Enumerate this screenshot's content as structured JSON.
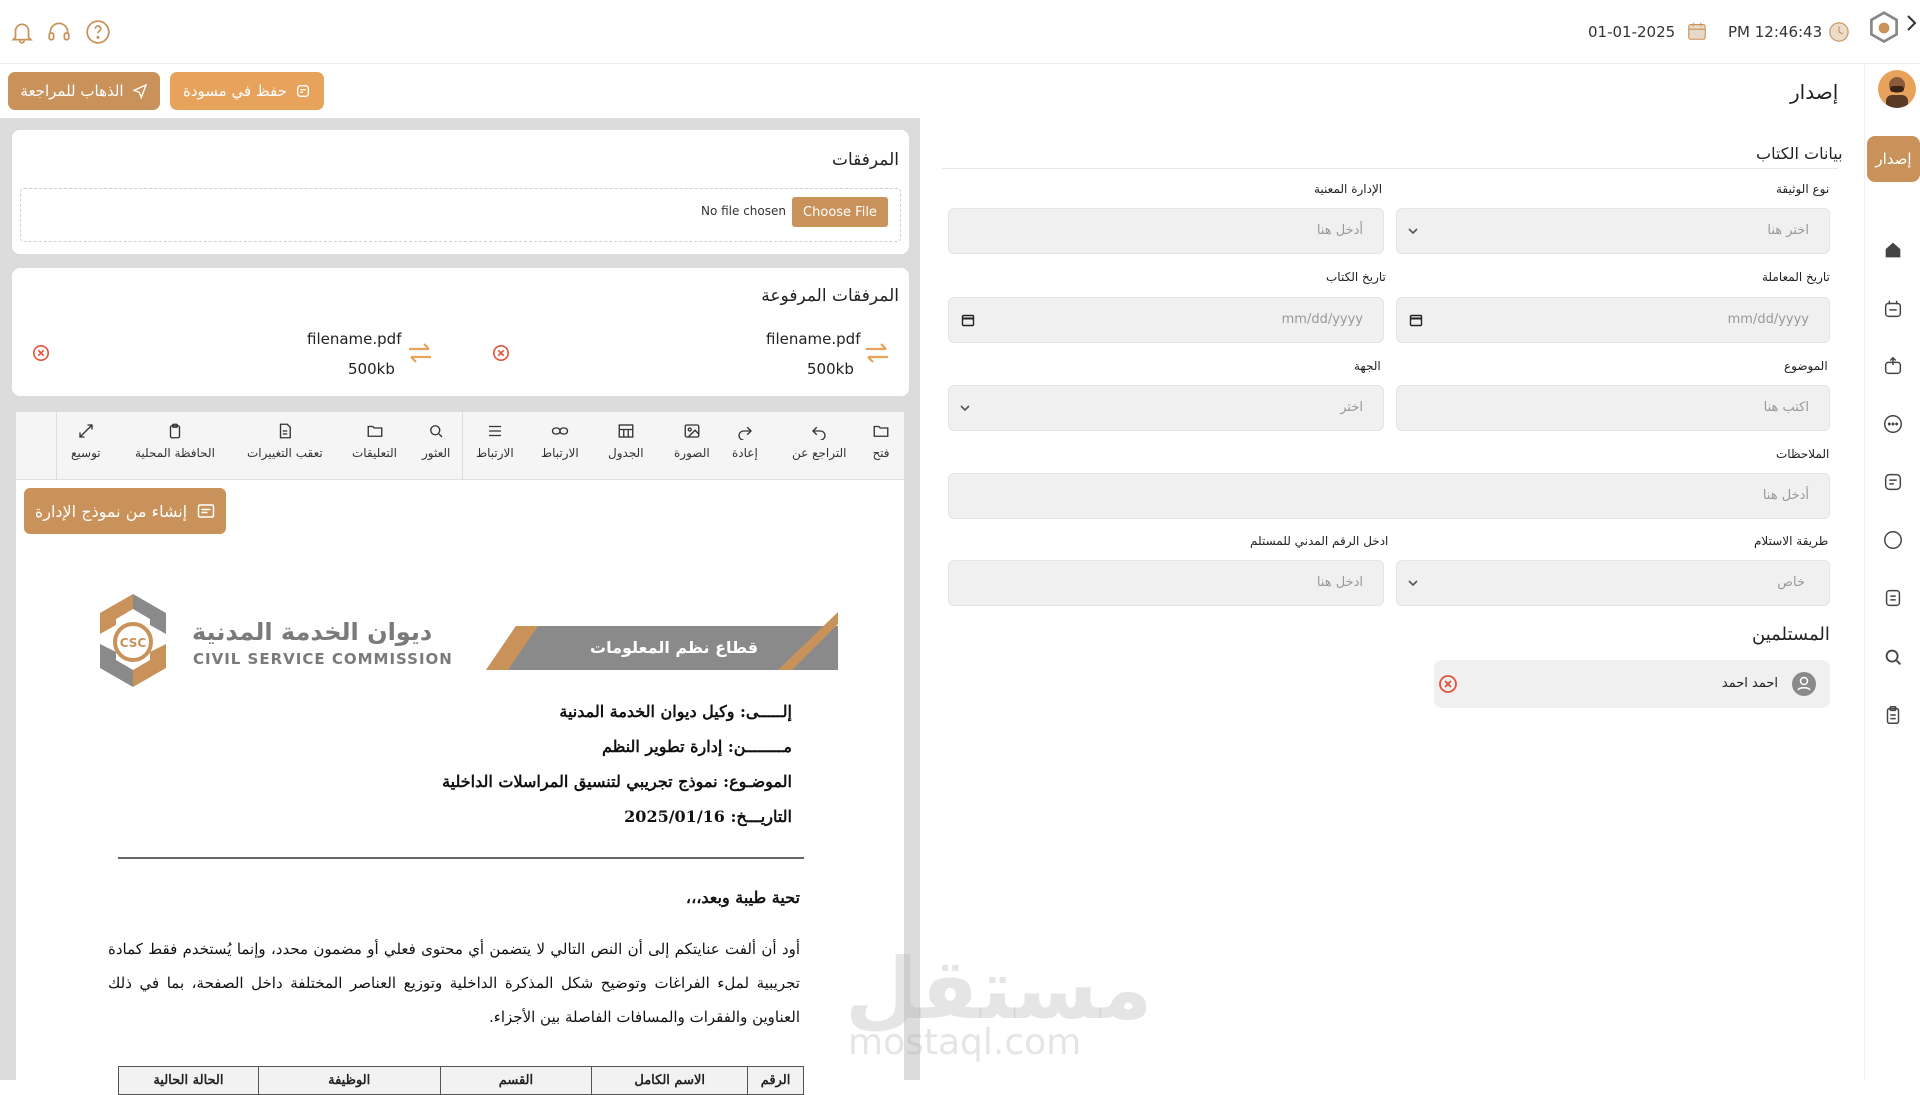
{
  "colors": {
    "accent": "#c8925a",
    "accent_light": "#e7a35c",
    "danger": "#e0533b",
    "panel_grey": "#dcdcdc"
  },
  "topbar": {
    "date": "01-01-2025",
    "time": "PM 12:46:43"
  },
  "header": {
    "title": "إصدار",
    "save_draft": "حفظ في مسودة",
    "go_review": "الذهاب للمراجعة"
  },
  "sidebar": {
    "active_label": "إصدار"
  },
  "attachments": {
    "title": "المرفقات",
    "choose_file": "Choose File",
    "no_file": "No file chosen"
  },
  "uploaded": {
    "title": "المرفقات المرفوعة",
    "files": [
      {
        "name": "filename.pdf",
        "size": "500kb"
      },
      {
        "name": "filename.pdf",
        "size": "500kb"
      }
    ]
  },
  "toolbar": {
    "items": [
      {
        "label": "فتح",
        "icon": "folder-icon"
      },
      {
        "label": "التراجع عن",
        "icon": "undo-icon"
      },
      {
        "label": "إعادة",
        "icon": "redo-icon"
      },
      {
        "label": "الصورة",
        "icon": "image-icon"
      },
      {
        "label": "الجدول",
        "icon": "table-icon"
      },
      {
        "label": "الارتباط",
        "icon": "link-icon"
      },
      {
        "label": "الارتباط",
        "icon": "list-icon"
      },
      {
        "label": "العثور",
        "icon": "search-icon"
      },
      {
        "label": "التعليقات",
        "icon": "folder-icon"
      },
      {
        "label": "تعقب التغييرات",
        "icon": "file-icon"
      },
      {
        "label": "الحافظة المحلية",
        "icon": "clipboard-icon"
      },
      {
        "label": "توسيع",
        "icon": "expand-icon"
      }
    ]
  },
  "document": {
    "template_button": "إنشاء من نموذج الإدارة",
    "logo_ar": "ديوان الخدمة المدنية",
    "logo_en": "CIVIL SERVICE COMMISSION",
    "logo_badge": "CSC",
    "banner": "قطاع نظم المعلومات",
    "to_line": "إلـــــى: وكيل ديوان الخدمة المدنية",
    "from_line": "مــــــــن: إدارة تطوير النظم",
    "subject_line": "الموضـوع: نموذج تجريبي لتنسيق المراسلات الداخلية",
    "date_line": "التاريـــخ: 2025/01/16",
    "greeting": "تحية طيبة وبعد،،،",
    "paragraph": "أود أن ألفت عنايتكم إلى أن النص التالي لا يتضمن أي محتوى فعلي أو مضمون محدد، وإنما يُستخدم فقط كمادة تجريبية لملء الفراغات وتوضيح شكل المذكرة الداخلية وتوزيع العناصر المختلفة داخل الصفحة، بما في ذلك العناوين والفقرات والمسافات الفاصلة بين الأجزاء.",
    "table_headers": [
      "الرقم",
      "الاسم الكامل",
      "القسم",
      "الوظيفة",
      "الحالة الحالية"
    ]
  },
  "form": {
    "section_title": "بيانات الكتاب",
    "doc_type": {
      "label": "نوع الوثيقة",
      "placeholder": "اختر هنا"
    },
    "department": {
      "label": "الإدارة المعنية",
      "placeholder": "أدخل هنا"
    },
    "transaction_date": {
      "label": "تاريخ المعاملة",
      "placeholder": "mm/dd/yyyy"
    },
    "letter_date": {
      "label": "تاريخ الكتاب",
      "placeholder": "mm/dd/yyyy"
    },
    "subject": {
      "label": "الموضوع",
      "placeholder": "اكتب هنا"
    },
    "entity": {
      "label": "الجهة",
      "placeholder": "اختر"
    },
    "notes": {
      "label": "الملاحظات",
      "placeholder": "أدخل هنا"
    },
    "receive_method": {
      "label": "طريقة الاستلام",
      "value": "خاص"
    },
    "civil_id": {
      "label": "ادخل الرقم المدني للمستلم",
      "placeholder": "ادخل هنا"
    }
  },
  "recipients": {
    "title": "المستلمين",
    "items": [
      {
        "name": "احمد احمد"
      }
    ]
  },
  "watermark": {
    "ar": "مستقل",
    "en": "mostaql.com"
  }
}
